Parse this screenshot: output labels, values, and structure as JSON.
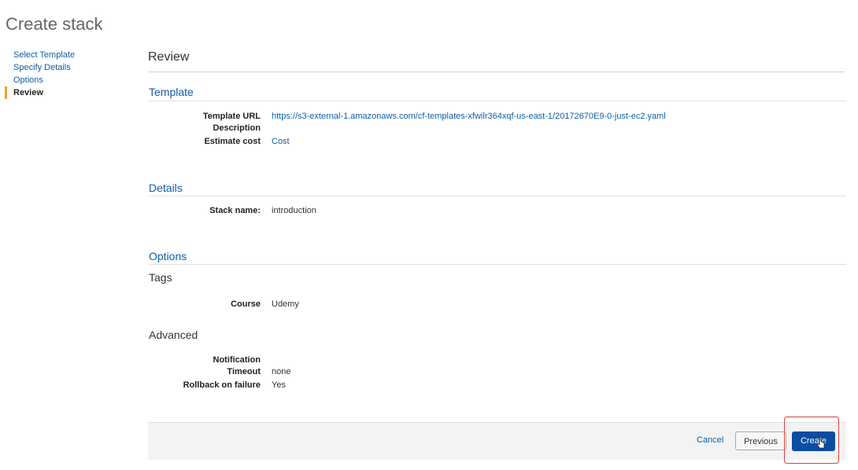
{
  "page": {
    "title": "Create stack"
  },
  "wizard": {
    "steps": [
      {
        "label": "Select Template",
        "active": false
      },
      {
        "label": "Specify Details",
        "active": false
      },
      {
        "label": "Options",
        "active": false
      },
      {
        "label": "Review",
        "active": true
      }
    ]
  },
  "review": {
    "heading": "Review",
    "template": {
      "title": "Template",
      "fields": {
        "url_label": "Template URL",
        "url_value": "https://s3-external-1.amazonaws.com/cf-templates-xfwilr364xqf-us-east-1/20172670E9-0-just-ec2.yaml",
        "description_label": "Description",
        "description_value": "",
        "cost_label": "Estimate cost",
        "cost_value": "Cost"
      }
    },
    "details": {
      "title": "Details",
      "stack_name_label": "Stack name:",
      "stack_name_value": "introduction"
    },
    "options": {
      "title": "Options",
      "tags_title": "Tags",
      "tag_key": "Course",
      "tag_value": "Udemy",
      "advanced_title": "Advanced",
      "notification_label": "Notification",
      "notification_value": "",
      "timeout_label": "Timeout",
      "timeout_value": "none",
      "rollback_label": "Rollback on failure",
      "rollback_value": "Yes"
    }
  },
  "footer": {
    "cancel_label": "Cancel",
    "previous_label": "Previous",
    "create_label": "Create"
  },
  "colors": {
    "link": "#0e5ea8",
    "active_step_marker": "#f0a029",
    "primary_button": "#0a4da2",
    "highlight_box": "#e04040"
  }
}
